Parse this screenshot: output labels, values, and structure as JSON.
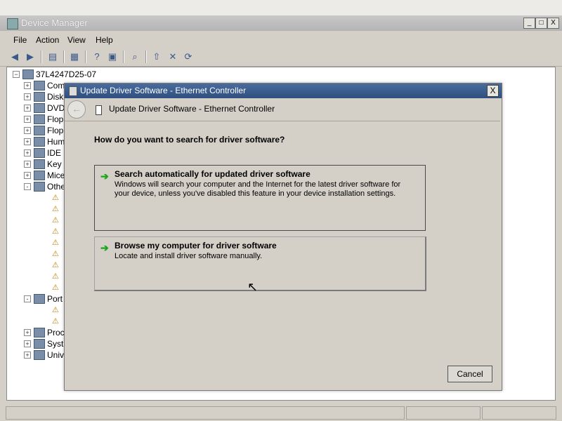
{
  "window": {
    "title": "Device Manager",
    "caption_buttons": [
      "_",
      "□",
      "X"
    ]
  },
  "menu": [
    "File",
    "Action",
    "View",
    "Help"
  ],
  "toolbar_icons": [
    "back-icon",
    "forward-icon",
    "up-icon",
    "properties-icon",
    "help-icon",
    "view-icon",
    "scan-icon",
    "update-driver-icon",
    "uninstall-icon",
    "enable-icon"
  ],
  "tree": {
    "root": "37L4247D25-07",
    "items": [
      {
        "label": "Com",
        "expander": "+"
      },
      {
        "label": "Disk",
        "expander": "+"
      },
      {
        "label": "DVD",
        "expander": "+"
      },
      {
        "label": "Flop",
        "expander": "+"
      },
      {
        "label": "Flop",
        "expander": "+"
      },
      {
        "label": "Hum",
        "expander": "+"
      },
      {
        "label": "IDE",
        "expander": "+"
      },
      {
        "label": "Key",
        "expander": "+"
      },
      {
        "label": "Mice",
        "expander": "+"
      },
      {
        "label": "Othe",
        "expander": "-"
      },
      {
        "label": "",
        "expander": ""
      },
      {
        "label": "",
        "expander": ""
      },
      {
        "label": "",
        "expander": ""
      },
      {
        "label": "",
        "expander": ""
      },
      {
        "label": "",
        "expander": ""
      },
      {
        "label": "",
        "expander": ""
      },
      {
        "label": "",
        "expander": ""
      },
      {
        "label": "",
        "expander": ""
      },
      {
        "label": "",
        "expander": ""
      },
      {
        "label": "Port",
        "expander": "-"
      },
      {
        "label": "",
        "expander": ""
      },
      {
        "label": "",
        "expander": ""
      },
      {
        "label": "Proc",
        "expander": "+"
      },
      {
        "label": "Syst",
        "expander": "+"
      },
      {
        "label": "Univ",
        "expander": "+"
      }
    ]
  },
  "dialog": {
    "title": "Update Driver Software - Ethernet Controller",
    "header": "Update Driver Software - Ethernet Controller",
    "question": "How do you want to search for driver software?",
    "options": [
      {
        "title": "Search automatically for updated driver software",
        "description": "Windows will search your computer and the Internet for the latest driver software for your device, unless you've disabled this feature in your device installation settings."
      },
      {
        "title": "Browse my computer for driver software",
        "description": "Locate and install driver software manually."
      }
    ],
    "cancel_label": "Cancel",
    "close_label": "X"
  },
  "colors": {
    "dialog_title_bar": "#2e4f80",
    "option_arrow": "#1aa61a"
  }
}
